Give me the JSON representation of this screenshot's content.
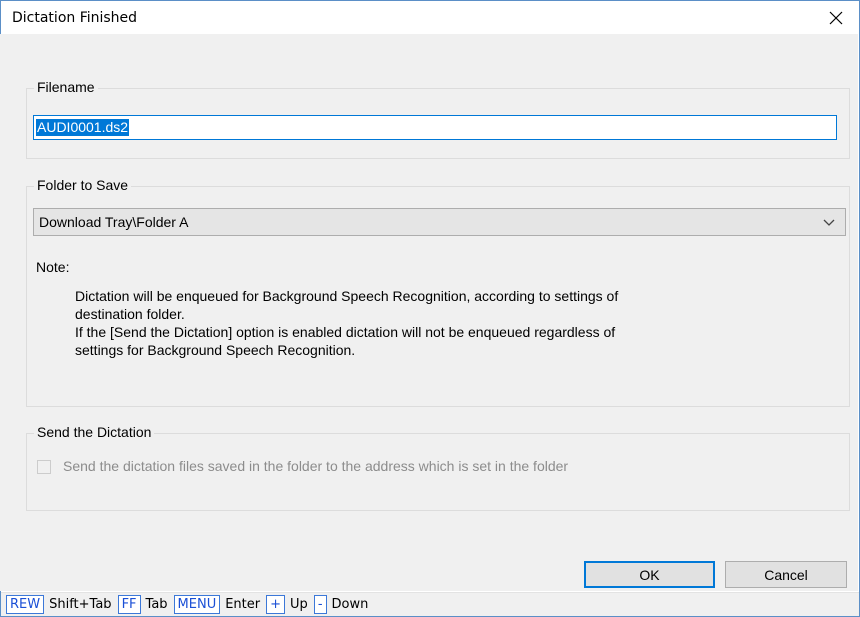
{
  "window": {
    "title": "Dictation Finished"
  },
  "filename": {
    "legend": "Filename",
    "value": "AUDI0001.ds2"
  },
  "folder": {
    "legend": "Folder to Save",
    "selected": "Download Tray\\Folder A",
    "note_label": "Note:",
    "note_text": "Dictation will be enqueued for Background Speech Recognition, according to settings of\ndestination folder.\nIf the [Send the Dictation] option is enabled dictation will not be enqueued regardless of\nsettings for Background Speech Recognition."
  },
  "send": {
    "legend": "Send the Dictation",
    "checkbox_label": "Send the dictation files saved in the folder to the address which is set in the folder",
    "checked": false
  },
  "buttons": {
    "ok": "OK",
    "cancel": "Cancel"
  },
  "statusbar": [
    {
      "key": "REW",
      "desc": "Shift+Tab"
    },
    {
      "key": "FF",
      "desc": "Tab"
    },
    {
      "key": "MENU",
      "desc": "Enter"
    },
    {
      "key": "+",
      "desc": "Up"
    },
    {
      "key": "-",
      "desc": "Down"
    }
  ],
  "colors": {
    "accent": "#0078d7",
    "key_text": "#1a4fd6",
    "disabled_text": "#8c8c8c"
  },
  "icons": {
    "close": "close-icon",
    "dropdown": "chevron-down-icon"
  }
}
